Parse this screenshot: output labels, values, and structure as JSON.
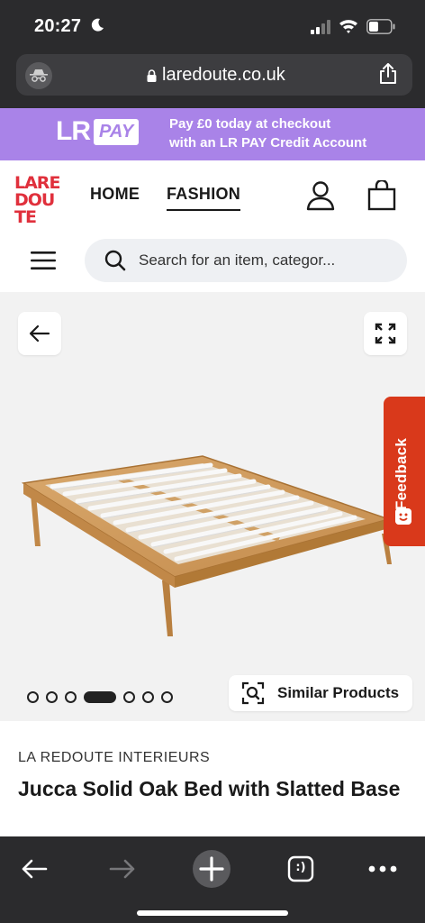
{
  "status_bar": {
    "time": "20:27",
    "icons": [
      "moon-icon",
      "signal-icon",
      "wifi-icon",
      "battery-icon"
    ]
  },
  "browser": {
    "url": "laredoute.co.uk",
    "icons": [
      "incognito-icon",
      "lock-icon",
      "share-icon"
    ]
  },
  "promo": {
    "logo_lr": "LR",
    "logo_pay": "PAY",
    "line1": "Pay £0 today at checkout",
    "line2": "with an LR PAY Credit Account",
    "color": "#a983e8"
  },
  "header": {
    "brand_lines": [
      "LARE",
      "DOU",
      "TE"
    ],
    "brand_color": "#e0303c",
    "nav": [
      {
        "label": "HOME",
        "active": false
      },
      {
        "label": "FASHION",
        "active": true
      }
    ],
    "icons": [
      "user-icon",
      "bag-icon",
      "menu-icon"
    ],
    "search_placeholder": "Search for an item, categor..."
  },
  "gallery": {
    "image_count": 7,
    "active_index": 3,
    "similar_label": "Similar Products",
    "feedback_label": "Feedback",
    "feedback_color": "#d9391b"
  },
  "product": {
    "brand": "LA REDOUTE INTERIEURS",
    "title": "Jucca Solid Oak Bed with Slatted Base"
  },
  "toolbar": {
    "icons": [
      "back-icon",
      "forward-icon",
      "new-tab-icon",
      "tabs-icon",
      "more-icon"
    ],
    "tabs_label": ":)"
  }
}
